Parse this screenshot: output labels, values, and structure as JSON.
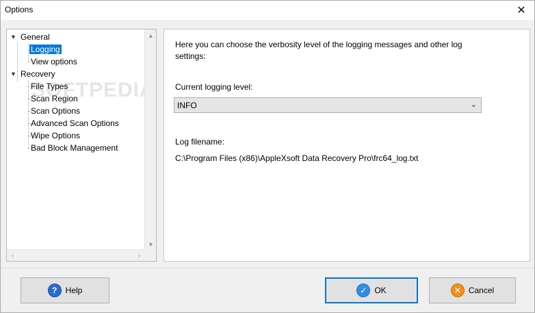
{
  "window": {
    "title": "Options"
  },
  "tree": {
    "items": [
      {
        "label": "General",
        "expanded": true
      },
      {
        "label": "Logging",
        "selected": true
      },
      {
        "label": "View options"
      },
      {
        "label": "Recovery",
        "expanded": true
      },
      {
        "label": "File Types"
      },
      {
        "label": "Scan Region"
      },
      {
        "label": "Scan Options"
      },
      {
        "label": "Advanced Scan Options"
      },
      {
        "label": "Wipe Options"
      },
      {
        "label": "Bad Block Management"
      }
    ]
  },
  "watermark": "SOFTPEDIA",
  "content": {
    "intro": "Here you can choose the verbosity level of the logging messages and other log settings:",
    "level_label": "Current logging level:",
    "level_value": "INFO",
    "file_label": "Log filename:",
    "file_path": "C:\\Program Files (x86)\\AppleXsoft Data Recovery Pro\\frc64_log.txt"
  },
  "buttons": {
    "help": "Help",
    "ok": "OK",
    "cancel": "Cancel"
  },
  "colors": {
    "selection": "#0078d7",
    "default_button_border": "#0078d7"
  },
  "icons": {
    "help": "help-icon",
    "ok": "check-icon",
    "cancel": "cancel-icon",
    "close": "close-icon"
  }
}
